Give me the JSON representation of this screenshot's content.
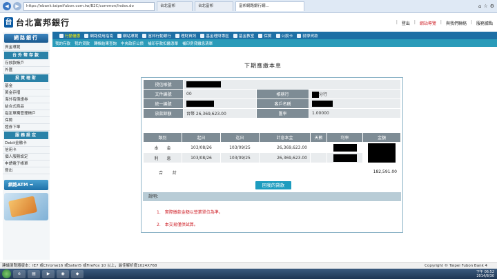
{
  "browser": {
    "address": "https://ebank.taipeifubon.com.tw/B2C/common/Index.do",
    "tabs": [
      "台北富邦",
      "台北富邦",
      "富邦網路銀行網..."
    ]
  },
  "site": {
    "logo_mark": "台",
    "logo_text": "台北富邦銀行",
    "top_links": [
      "登出",
      "網站導覽",
      "與我們聯絡",
      "服務據點"
    ]
  },
  "topnav": [
    "行動優惠",
    "網路使用指南",
    "網站導覽",
    "富邦行動銀行",
    "理財資訊",
    "基金理財專區",
    "基金教室",
    "保險",
    "公股卡",
    "就學貸款"
  ],
  "subnav": [
    "我的存款",
    "我的貸款",
    "轉帳結果查詢",
    "中央政府公債",
    "補印存款扣繳憑單",
    "補印房貸繳息清單"
  ],
  "sidebar": {
    "title": "網路銀行",
    "top_item": "資金導覽",
    "sections": [
      {
        "title": "台外幣存款",
        "items": [
          "存放款帳戶",
          "外匯"
        ]
      },
      {
        "title": "投資理財",
        "items": [
          "基金",
          "黃金存摺",
          "海外有價證券",
          "結合式商品",
          "指定單獨管理帳戶",
          "保險",
          "證券下單"
        ]
      },
      {
        "title": "服務設定",
        "items": [
          "Debit金融卡",
          "信用卡",
          "個人服務設定",
          "申請電子帳單",
          "登出"
        ]
      }
    ],
    "atm_label": "網路ATM ➡"
  },
  "main": {
    "title": "下期應繳本息",
    "info": {
      "account_label": "授信帳號",
      "doc_label": "文件編號",
      "doc_value": "00",
      "branch_label": "帳務行",
      "branch_suffix": "分行",
      "id_label": "統一編號",
      "name_label": "客戶名稱",
      "amount_label": "放款餘額",
      "amount_value": "台幣 26,369,623.00",
      "rate_label": "匯率",
      "rate_value": "1.00000"
    },
    "detail_headers": [
      "類別",
      "起日",
      "迄日",
      "計息本金",
      "天數",
      "利率",
      "金額"
    ],
    "detail_rows": [
      {
        "type": "本　　金",
        "start": "103/08/26",
        "end": "103/09/25",
        "principal": "26,369,623.00"
      },
      {
        "type": "利　　息",
        "start": "103/08/26",
        "end": "103/09/25",
        "principal": "26,369,623.00"
      }
    ],
    "total_label": "合 計",
    "total_value": "182,591.00",
    "back_button": "回我的貸款",
    "notes_title": "說明：",
    "notes": [
      "1.　實際繳款金額以營業單位為準。",
      "2.　本交易僅供試算。"
    ]
  },
  "status_line": "建議瀏覽器版本：IE7 或Chrome16 或Safari5 或FireFox 10 以上，最佳解析度1024X768",
  "copyright": "Copyright © Taipei Fubon Bank 4",
  "clock": {
    "time": "下午 06:52",
    "date": "2014/8/30"
  }
}
